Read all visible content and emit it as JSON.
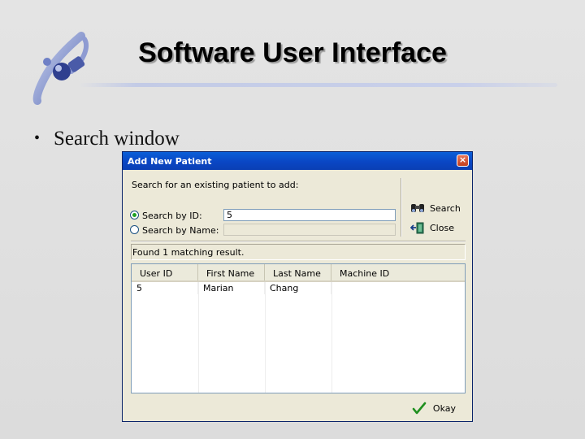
{
  "slide": {
    "title": "Software User Interface",
    "bullet_symbol": "•",
    "bullet_text": "Search window"
  },
  "dialog": {
    "title": "Add New Patient",
    "close_symbol": "×",
    "prompt": "Search for an existing patient to add:",
    "search_by_id_label": "Search by ID:",
    "search_by_id_value": "5",
    "search_by_id_selected": true,
    "search_by_name_label": "Search by Name:",
    "search_by_name_value": "",
    "search_button_label": "Search",
    "close_button_label": "Close",
    "status_text": "Found 1 matching result.",
    "table": {
      "columns": [
        "User ID",
        "First Name",
        "Last Name",
        "Machine ID"
      ],
      "rows": [
        [
          "5",
          "Marian",
          "Chang",
          ""
        ]
      ]
    },
    "okay_button_label": "Okay"
  },
  "colors": {
    "titlebar": "#0a46c4",
    "dialog_bg": "#ece9d8",
    "check_green": "#1f8f1f"
  }
}
